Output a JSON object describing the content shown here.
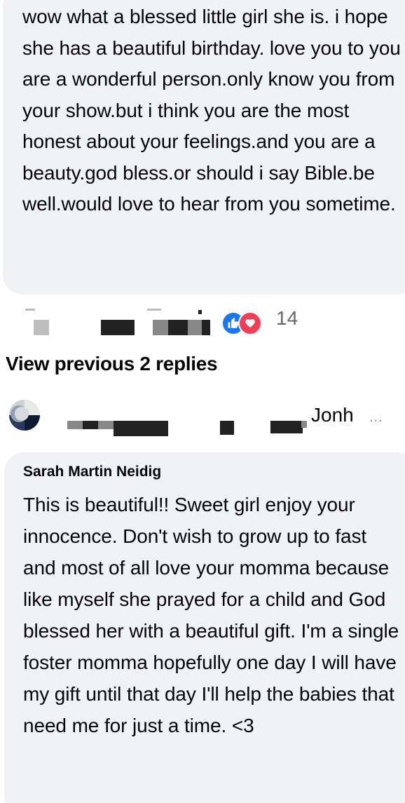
{
  "first_comment": {
    "text": "wow what a blessed little girl she is. i hope she has a beautiful birthday. love you to you are a wonderful person.only know you from your show.but i think you are the most honest about your feelings.and you are a beauty.god bless.or should i say Bible.be well.would love to hear from you sometime."
  },
  "first_comment_actions": {
    "reaction_icons": [
      "like-icon",
      "love-icon"
    ],
    "reaction_count": "14"
  },
  "view_previous": {
    "label": "View previous 2 replies"
  },
  "collapsed_reply": {
    "name": "Jonh",
    "ellipsis": "..."
  },
  "second_comment": {
    "author": "Sarah Martin Neidig",
    "text": "This is beautiful!! Sweet girl enjoy your innocence. Don't wish to grow up to fast and most of all love your momma because like myself she prayed for a child and God blessed her with a beautiful gift. I'm a single foster momma hopefully one day I will have my gift until that day I'll help the babies that need me for just a time. <3"
  },
  "colors": {
    "bubble": "#f0f2f5",
    "like_blue": "#1877f2",
    "love_red": "#f33e58",
    "meta_gray": "#65676b"
  }
}
